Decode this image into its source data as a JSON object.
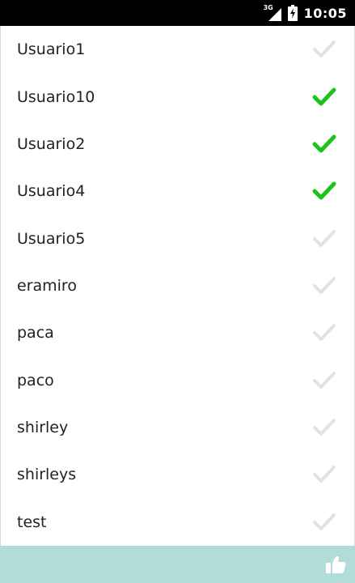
{
  "status_bar": {
    "network_type": "3G",
    "time": "10:05",
    "icons": [
      "signal-icon",
      "battery-charging-icon"
    ]
  },
  "users": [
    {
      "name": "Usuario1",
      "checked": false
    },
    {
      "name": "Usuario10",
      "checked": true
    },
    {
      "name": "Usuario2",
      "checked": true
    },
    {
      "name": "Usuario4",
      "checked": true
    },
    {
      "name": "Usuario5",
      "checked": false
    },
    {
      "name": "eramiro",
      "checked": false
    },
    {
      "name": "paca",
      "checked": false
    },
    {
      "name": "paco",
      "checked": false
    },
    {
      "name": "shirley",
      "checked": false
    },
    {
      "name": "shirleys",
      "checked": false
    },
    {
      "name": "test",
      "checked": false
    }
  ],
  "bottom_bar": {
    "icon": "thumbs-up-icon"
  },
  "colors": {
    "checked": "#1ec21a",
    "unchecked": "#e2e2e2",
    "bottom_bar": "#b2dcd7",
    "status_bar": "#000000"
  }
}
